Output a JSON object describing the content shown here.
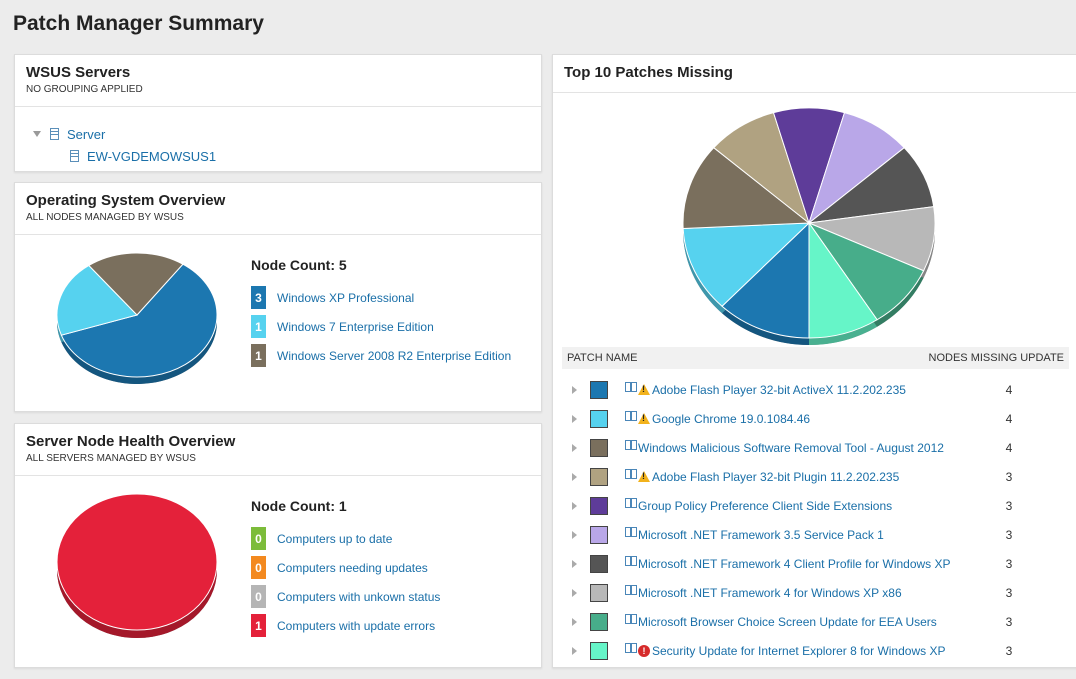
{
  "page": {
    "title": "Patch Manager Summary"
  },
  "wsus": {
    "title": "WSUS Servers",
    "subtitle": "NO GROUPING APPLIED",
    "group_label": "Server",
    "server_name": "EW-VGDEMOWSUS1"
  },
  "os_overview": {
    "title": "Operating System Overview",
    "subtitle": "ALL NODES MANAGED BY WSUS",
    "count_label": "Node Count: 5",
    "items": [
      {
        "count": "3",
        "label": "Windows XP Professional",
        "color": "#1c77b0"
      },
      {
        "count": "1",
        "label": "Windows 7 Enterprise Edition",
        "color": "#56d2ef"
      },
      {
        "count": "1",
        "label": "Windows Server 2008 R2 Enterprise Edition",
        "color": "#7a6f5d"
      }
    ]
  },
  "health": {
    "title": "Server Node Health Overview",
    "subtitle": "ALL SERVERS MANAGED BY WSUS",
    "count_label": "Node Count: 1",
    "items": [
      {
        "count": "0",
        "label": "Computers up to date",
        "color": "#7cbc3a"
      },
      {
        "count": "0",
        "label": "Computers needing updates",
        "color": "#f3891f"
      },
      {
        "count": "0",
        "label": "Computers with unkown status",
        "color": "#b5b5b5"
      },
      {
        "count": "1",
        "label": "Computers with update errors",
        "color": "#e4213a"
      }
    ]
  },
  "patches": {
    "title": "Top 10 Patches Missing",
    "col_name": "PATCH NAME",
    "col_count": "NODES MISSING UPDATE",
    "rows": [
      {
        "name": "Adobe Flash Player 32-bit ActiveX 11.2.202.235",
        "count": "4",
        "color": "#1c77b0",
        "status": "warning"
      },
      {
        "name": "Google Chrome 19.0.1084.46",
        "count": "4",
        "color": "#56d2ef",
        "status": "warning"
      },
      {
        "name": "Windows Malicious Software Removal Tool - August 2012",
        "count": "4",
        "color": "#7a6f5d",
        "status": "none"
      },
      {
        "name": "Adobe Flash Player 32-bit Plugin 11.2.202.235",
        "count": "3",
        "color": "#b0a281",
        "status": "warning"
      },
      {
        "name": "Group Policy Preference Client Side Extensions",
        "count": "3",
        "color": "#5e3c99",
        "status": "none"
      },
      {
        "name": "Microsoft .NET Framework 3.5 Service Pack 1",
        "count": "3",
        "color": "#b9a7e8",
        "status": "none"
      },
      {
        "name": "Microsoft .NET Framework 4 Client Profile for Windows XP",
        "count": "3",
        "color": "#555555",
        "status": "none"
      },
      {
        "name": "Microsoft .NET Framework 4 for Windows XP x86",
        "count": "3",
        "color": "#b8b8b8",
        "status": "none"
      },
      {
        "name": "Microsoft Browser Choice Screen Update for EEA Users",
        "count": "3",
        "color": "#47ad8a",
        "status": "none"
      },
      {
        "name": "Security Update for Internet Explorer 8 for Windows XP",
        "count": "3",
        "color": "#66f5c8",
        "status": "error"
      }
    ]
  }
}
